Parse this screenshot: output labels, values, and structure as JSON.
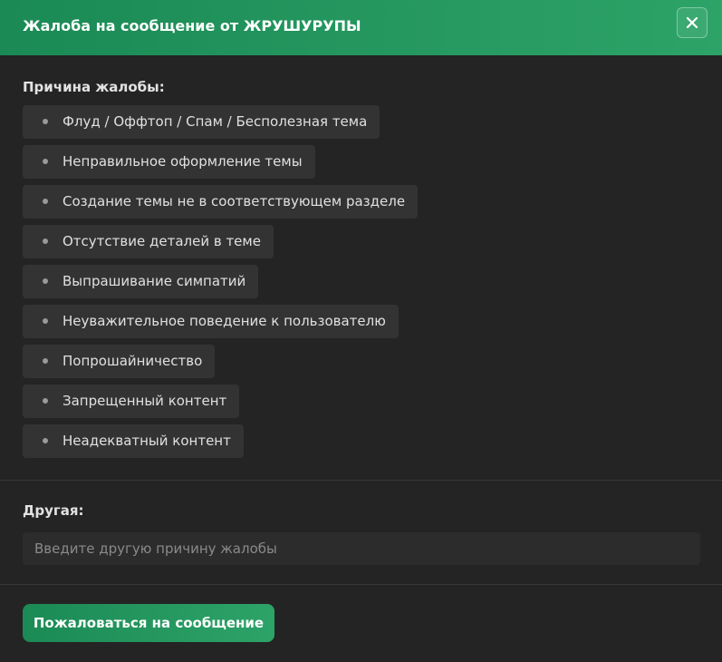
{
  "header": {
    "title": "Жалоба на сообщение от ЖРУШУРУПЫ",
    "close_icon": "close-icon"
  },
  "reasons": {
    "label": "Причина жалобы:",
    "items": [
      "Флуд / Оффтоп / Спам / Бесполезная тема",
      "Неправильное оформление темы",
      "Создание темы не в соответствующем разделе",
      "Отсутствие деталей в теме",
      "Выпрашивание симпатий",
      "Неуважительное поведение к пользователю",
      "Попрошайничество",
      "Запрещенный контент",
      "Неадекватный контент"
    ]
  },
  "other": {
    "label": "Другая:",
    "placeholder": "Введите другую причину жалобы",
    "value": ""
  },
  "submit": {
    "label": "Пожаловаться на сообщение"
  },
  "colors": {
    "accent_start": "#1b8a55",
    "accent_end": "#2da368",
    "background": "#242424",
    "chip": "#333333"
  }
}
